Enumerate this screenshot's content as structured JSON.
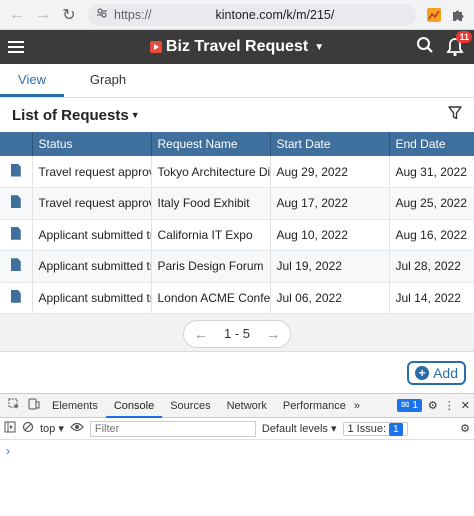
{
  "browser": {
    "url_prefix": "https://",
    "url_main": "kintone.com/k/m/215/"
  },
  "app": {
    "title": "Biz Travel Request",
    "notification_count": "11"
  },
  "tabs": [
    {
      "label": "View"
    },
    {
      "label": "Graph"
    }
  ],
  "list": {
    "title": "List of Requests",
    "columns": [
      "Status",
      "Request Name",
      "Start Date",
      "End Date"
    ],
    "rows": [
      {
        "status": "Travel request approved",
        "name": "Tokyo Architecture Display",
        "start": "Aug 29, 2022",
        "end": "Aug 31, 2022"
      },
      {
        "status": "Travel request approved",
        "name": "Italy Food Exhibit",
        "start": "Aug 17, 2022",
        "end": "Aug 25, 2022"
      },
      {
        "status": "Applicant submitted travel",
        "name": "California IT Expo",
        "start": "Aug 10, 2022",
        "end": "Aug 16, 2022"
      },
      {
        "status": "Applicant submitted travel",
        "name": "Paris Design Forum",
        "start": "Jul 19, 2022",
        "end": "Jul 28, 2022"
      },
      {
        "status": "Applicant submitted travel",
        "name": "London ACME Conference",
        "start": "Jul 06, 2022",
        "end": "Jul 14, 2022"
      }
    ]
  },
  "pager": {
    "label": "1 - 5"
  },
  "add_button": {
    "label": "Add"
  },
  "devtools": {
    "tabs": [
      "Elements",
      "Console",
      "Sources",
      "Network",
      "Performance"
    ],
    "more": "»",
    "message_count": "1",
    "context": "top",
    "filter_placeholder": "Filter",
    "levels": "Default levels",
    "issues": "1 Issue:",
    "issues_count": "1",
    "prompt": "›"
  }
}
